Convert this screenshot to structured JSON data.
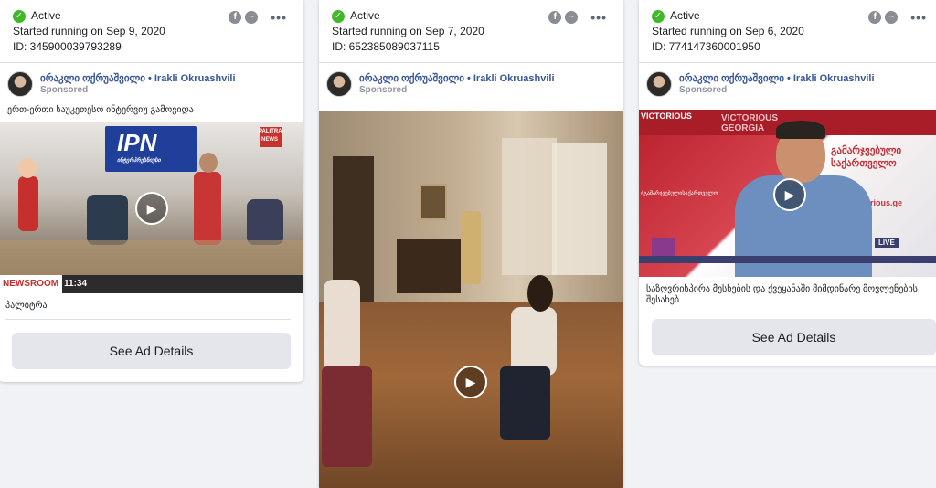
{
  "cards": [
    {
      "status": "Active",
      "started": "Started running on Sep 9, 2020",
      "id": "ID: 345900039793289",
      "page_name": "ირაკლი ოქრუაშვილი • Irakli Okruashvili",
      "sponsored": "Sponsored",
      "body_text": "ერთ-ერთი საუკეთესო ინტერვიუ გამოვიდა",
      "caption": "პალიტრა",
      "cta": "See Ad Details",
      "media_overlay": {
        "logo": "IPN",
        "logo_sub": "ინტერპრესნიუსი",
        "brand": "PALITRA",
        "brand_sub": "NEWS",
        "lower_left": "NEWSROOM",
        "time": "11:34"
      }
    },
    {
      "status": "Active",
      "started": "Started running on Sep 7, 2020",
      "id": "ID: 652385089037115",
      "page_name": "ირაკლი ოქრუაშვილი • Irakli Okruashvili",
      "sponsored": "Sponsored"
    },
    {
      "status": "Active",
      "started": "Started running on Sep 6, 2020",
      "id": "ID: 774147360001950",
      "page_name": "ირაკლი ოქრუაშვილი • Irakli Okruashvili",
      "sponsored": "Sponsored",
      "caption": "საზღვრისპირა მესხების და ქვეყანაში მიმდინარე მოვლენების შესახებ",
      "cta": "See Ad Details",
      "media_overlay": {
        "top_left": "VICTORIOUS",
        "brand_large": "VICTORIOUS",
        "brand_line2": "GEORGIA",
        "headline": "გამარჯვებული საქართველო",
        "hashtag": "#გამარჯვებულისაქართველო",
        "site": "victorious.ge",
        "live": "LIVE"
      }
    }
  ],
  "icons": {
    "status": "check-icon",
    "platform_1": "facebook-icon",
    "platform_2": "messenger-icon",
    "more": "more-options-icon",
    "play": "play-icon"
  },
  "colors": {
    "active_green": "#42b72a",
    "page_name_blue": "#385898",
    "button_bg": "#e4e6eb"
  }
}
